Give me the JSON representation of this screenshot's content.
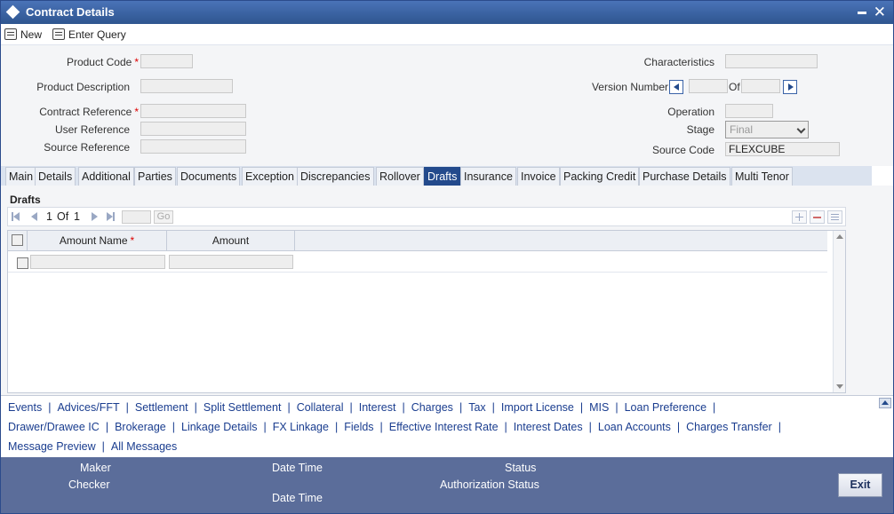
{
  "window": {
    "title": "Contract Details"
  },
  "toolbar": {
    "new_label": "New",
    "enter_query_label": "Enter Query"
  },
  "form": {
    "product_code_label": "Product Code",
    "product_description_label": "Product Description",
    "contract_reference_label": "Contract Reference",
    "user_reference_label": "User Reference",
    "source_reference_label": "Source Reference",
    "characteristics_label": "Characteristics",
    "version_number_label": "Version Number",
    "of_label": "Of",
    "operation_label": "Operation",
    "stage_label": "Stage",
    "stage_value": "Final",
    "source_code_label": "Source Code",
    "source_code_value": "FLEXCUBE",
    "required_marker": "*"
  },
  "tabs": [
    {
      "label": "Main"
    },
    {
      "label": "Details"
    },
    {
      "label": "Additional"
    },
    {
      "label": "Parties"
    },
    {
      "label": "Documents"
    },
    {
      "label": "Exception"
    },
    {
      "label": "Discrepancies"
    },
    {
      "label": "Rollover"
    },
    {
      "label": "Drafts"
    },
    {
      "label": "Insurance"
    },
    {
      "label": "Invoice"
    },
    {
      "label": "Packing Credit"
    },
    {
      "label": "Purchase Details"
    },
    {
      "label": "Multi Tenor"
    }
  ],
  "active_tab": "Drafts",
  "drafts": {
    "section_title": "Drafts",
    "pager": {
      "current": "1",
      "of_label": "Of",
      "total": "1",
      "go_label": "Go"
    },
    "columns": [
      "Amount Name",
      "Amount"
    ]
  },
  "links_row1": [
    "Events",
    "Advices/FFT",
    "Settlement",
    "Split Settlement",
    "Collateral",
    "Interest",
    "Charges",
    "Tax",
    "Import License",
    "MIS",
    "Loan Preference"
  ],
  "links_row2": [
    "Drawer/Drawee IC",
    "Brokerage",
    "Linkage Details",
    "FX Linkage",
    "Fields",
    "Effective Interest Rate",
    "Interest Dates",
    "Loan Accounts",
    "Charges Transfer"
  ],
  "links_row3": [
    "Message Preview",
    "All Messages"
  ],
  "footer": {
    "maker_label": "Maker",
    "checker_label": "Checker",
    "date_time_label": "Date Time",
    "status_label": "Status",
    "authorization_status_label": "Authorization Status",
    "exit_label": "Exit"
  }
}
